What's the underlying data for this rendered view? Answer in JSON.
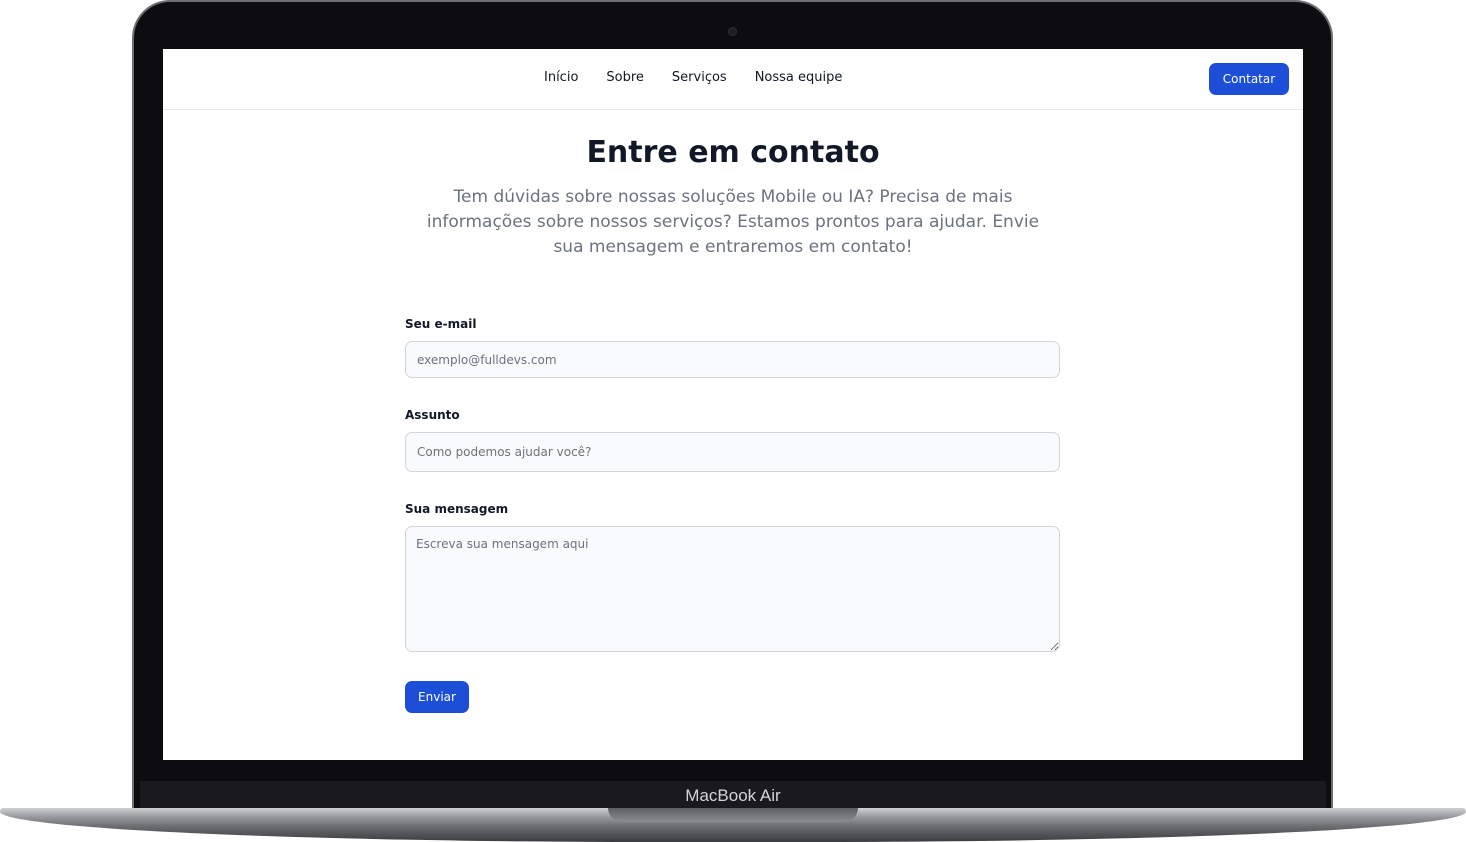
{
  "device": {
    "model_label": "MacBook Air"
  },
  "nav": {
    "links": [
      "Início",
      "Sobre",
      "Serviços",
      "Nossa equipe"
    ],
    "cta_label": "Contatar"
  },
  "contact": {
    "title": "Entre em contato",
    "subtitle": "Tem dúvidas sobre nossas soluções Mobile ou IA? Precisa de mais informações sobre nossos serviços? Estamos prontos para ajudar. Envie sua mensagem e entraremos em contato!",
    "email": {
      "label": "Seu e-mail",
      "placeholder": "exemplo@fulldevs.com",
      "value": ""
    },
    "subject": {
      "label": "Assunto",
      "placeholder": "Como podemos ajudar você?",
      "value": ""
    },
    "message": {
      "label": "Sua mensagem",
      "placeholder": "Escreva sua mensagem aqui",
      "value": ""
    },
    "submit_label": "Enviar"
  },
  "colors": {
    "primary": "#1d4ed8",
    "text": "#111827",
    "muted": "#6b7280",
    "field_bg": "#f9fafb",
    "field_border": "#d1d5db"
  }
}
